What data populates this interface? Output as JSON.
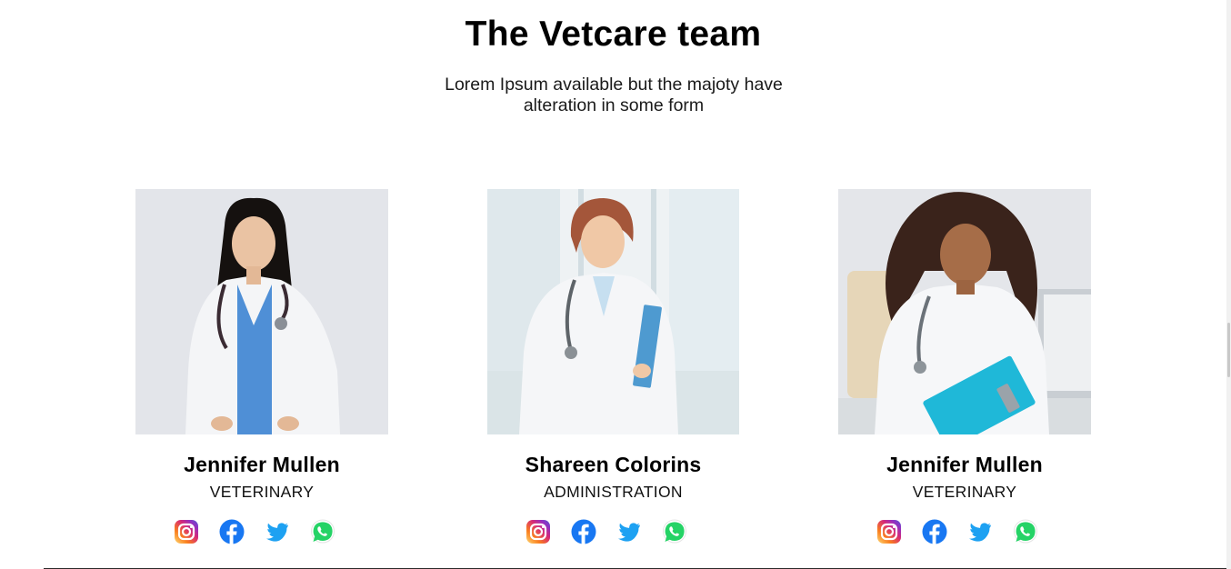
{
  "header": {
    "title": "The Vetcare team",
    "subtitle": "Lorem Ipsum available but the majoty have alteration in some form"
  },
  "team": [
    {
      "name": "Jennifer Mullen",
      "role": "VETERINARY",
      "photo": "doctor-portrait-long-black-hair"
    },
    {
      "name": "Shareen Colorins",
      "role": "ADMINISTRATION",
      "photo": "doctor-portrait-auburn-bob-clipboard"
    },
    {
      "name": "Jennifer Mullen",
      "role": "VETERINARY",
      "photo": "doctor-portrait-curly-hair-clipboard"
    }
  ],
  "social_icons": [
    "instagram-icon",
    "facebook-icon",
    "twitter-icon",
    "whatsapp-icon"
  ],
  "colors": {
    "facebook": "#1877F2",
    "twitter": "#1DA1F2",
    "whatsapp": "#25D366",
    "instagram_gradient": [
      "#FEDA75",
      "#FA7E1E",
      "#D62976",
      "#962FBF",
      "#4F5BD5"
    ]
  }
}
